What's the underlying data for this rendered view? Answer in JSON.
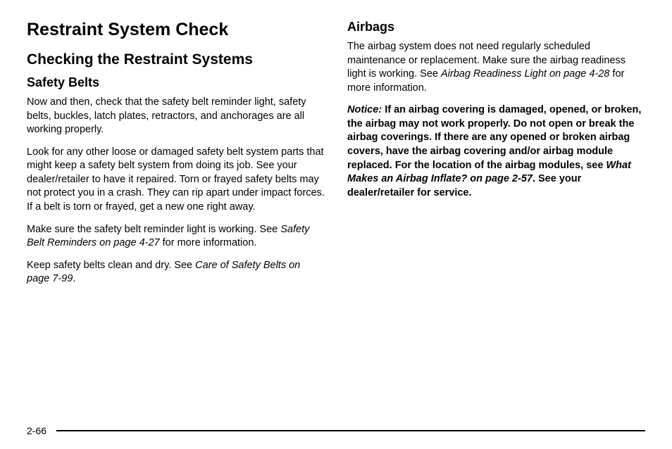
{
  "left": {
    "h1": "Restraint System Check",
    "h2": "Checking the Restraint Systems",
    "h3": "Safety Belts",
    "p1": "Now and then, check that the safety belt reminder light, safety belts, buckles, latch plates, retractors, and anchorages are all working properly.",
    "p2": "Look for any other loose or damaged safety belt system parts that might keep a safety belt system from doing its job. See your dealer/retailer to have it repaired. Torn or frayed safety belts may not protect you in a crash. They can rip apart under impact forces. If a belt is torn or frayed, get a new one right away.",
    "p3a": "Make sure the safety belt reminder light is working. See ",
    "p3_ref": "Safety Belt Reminders on page 4-27",
    "p3b": " for more information.",
    "p4a": "Keep safety belts clean and dry. See ",
    "p4_ref": "Care of Safety Belts on page 7-99",
    "p4b": "."
  },
  "right": {
    "h3": "Airbags",
    "p1a": "The airbag system does not need regularly scheduled maintenance or replacement. Make sure the airbag readiness light is working. See ",
    "p1_ref": "Airbag Readiness Light on page 4-28",
    "p1b": " for more information.",
    "notice_label": "Notice:",
    "notice_a": "If an airbag covering is damaged, opened, or broken, the airbag may not work properly. Do not open or break the airbag coverings. If there are any opened or broken airbag covers, have the airbag covering and/or airbag module replaced. For the location of the airbag modules, see ",
    "notice_ref": "What Makes an Airbag Inflate? on page 2-57",
    "notice_b": ". See your dealer/retailer for service."
  },
  "page_number": "2-66"
}
